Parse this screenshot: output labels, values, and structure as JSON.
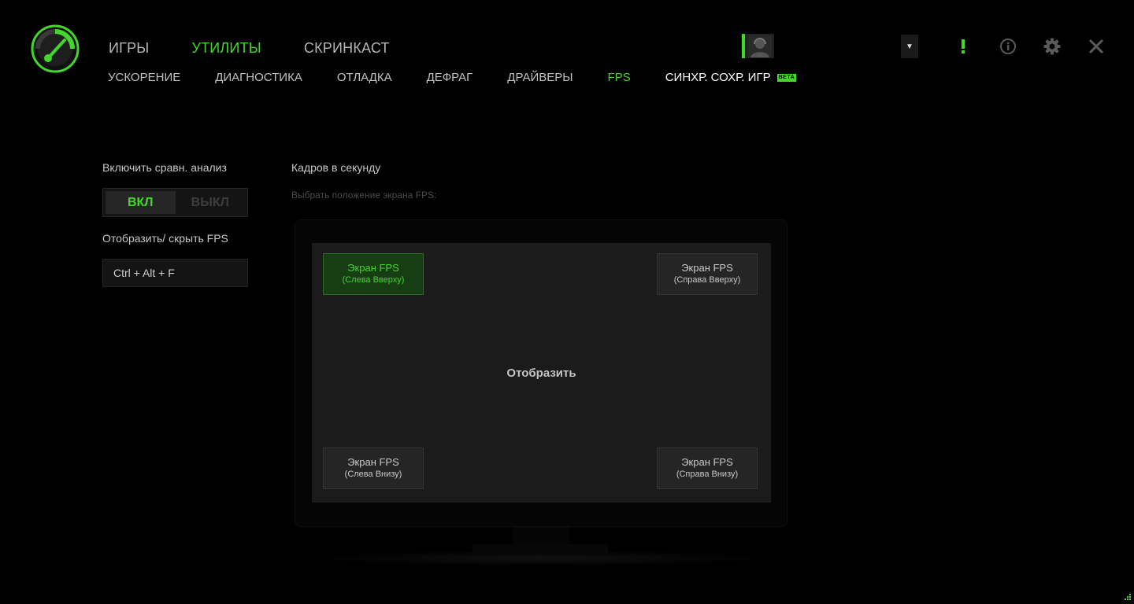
{
  "app": {
    "accent": "#44d62c"
  },
  "nav": {
    "main": [
      {
        "label": "ИГРЫ"
      },
      {
        "label": "УТИЛИТЫ"
      },
      {
        "label": "СКРИНКАСТ"
      }
    ],
    "sub": [
      {
        "label": "УСКОРЕНИЕ"
      },
      {
        "label": "ДИАГНОСТИКА"
      },
      {
        "label": "ОТЛАДКА"
      },
      {
        "label": "ДЕФРАГ"
      },
      {
        "label": "ДРАЙВЕРЫ"
      },
      {
        "label": "FPS"
      },
      {
        "label": "СИНХР. СОХР. ИГР",
        "badge": "BETA"
      }
    ]
  },
  "topbar": {
    "avatar_icon": "user-avatar-icon",
    "dropdown_icon": "caret-down-icon",
    "alert_icon": "exclamation-icon",
    "info_icon": "info-icon",
    "settings_icon": "gear-icon",
    "close_icon": "close-icon"
  },
  "left": {
    "benchmark_label": "Включить сравн. анализ",
    "toggle": {
      "on": "ВКЛ",
      "off": "ВЫКЛ",
      "state": "on"
    },
    "hotkey_label": "Отобразить/ скрыть FPS",
    "hotkey_value": "Ctrl + Alt + F"
  },
  "right": {
    "title": "Кадров в секунду",
    "subtitle": "Выбрать положение экрана FPS:",
    "show_label": "Отобразить",
    "positions": {
      "top_left": {
        "line1": "Экран FPS",
        "line2": "(Слева Вверху)",
        "selected": true
      },
      "top_right": {
        "line1": "Экран FPS",
        "line2": "(Справа Вверху)",
        "selected": false
      },
      "bottom_left": {
        "line1": "Экран FPS",
        "line2": "(Слева Внизу)",
        "selected": false
      },
      "bottom_right": {
        "line1": "Экран FPS",
        "line2": "(Справа Внизу)",
        "selected": false
      }
    }
  }
}
